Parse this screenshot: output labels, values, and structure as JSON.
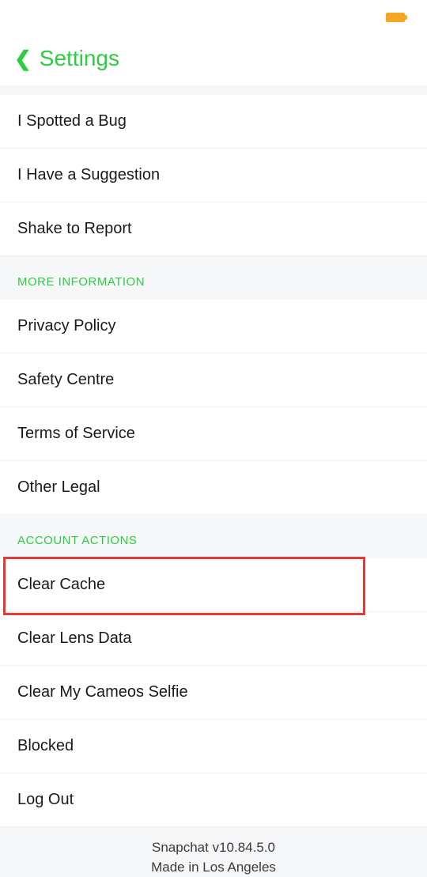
{
  "header": {
    "title": "Settings"
  },
  "sections": {
    "feedback": {
      "items": [
        "I Spotted a Bug",
        "I Have a Suggestion",
        "Shake to Report"
      ]
    },
    "more_info": {
      "header": "MORE INFORMATION",
      "items": [
        "Privacy Policy",
        "Safety Centre",
        "Terms of Service",
        "Other Legal"
      ]
    },
    "account_actions": {
      "header": "ACCOUNT ACTIONS",
      "items": [
        "Clear Cache",
        "Clear Lens Data",
        "Clear My Cameos Selfie",
        "Blocked",
        "Log Out"
      ]
    }
  },
  "footer": {
    "version": "Snapchat v10.84.5.0",
    "tagline": "Made in Los Angeles"
  }
}
